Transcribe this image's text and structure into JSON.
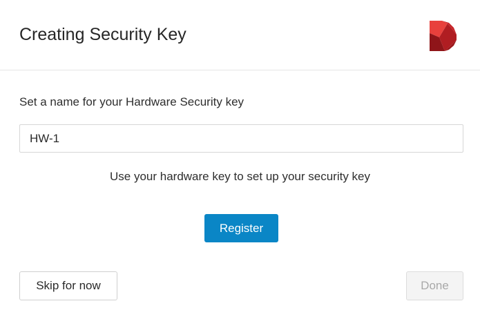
{
  "dialog": {
    "title": "Creating Security Key",
    "logo": {
      "icon": "dell-emc-d-logo-icon",
      "colors": [
        "#e63a3a",
        "#b81f24",
        "#8e1418"
      ]
    }
  },
  "form": {
    "label": "Set a name for your Hardware Security key",
    "name_value": "HW-1",
    "instruction": "Use your hardware key to set up your security key"
  },
  "buttons": {
    "register": "Register",
    "skip": "Skip for now",
    "done": "Done"
  },
  "colors": {
    "accent": "#0a86c6",
    "disabled_text": "#a8a8a8",
    "divider": "#e6e6e6"
  }
}
